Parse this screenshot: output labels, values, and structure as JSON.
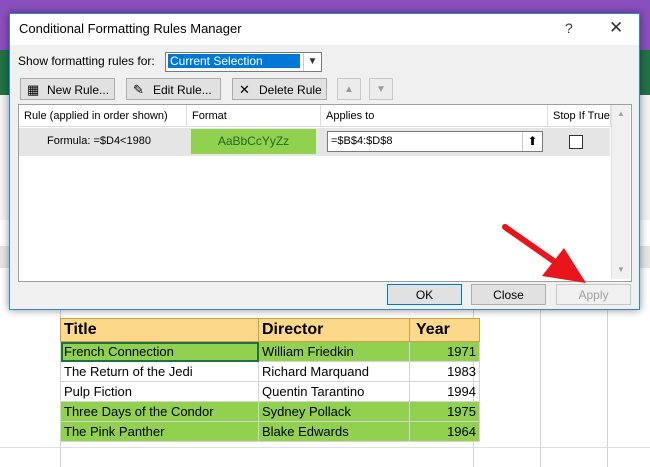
{
  "dialog": {
    "title": "Conditional Formatting Rules Manager",
    "help": "?",
    "close": "✕",
    "show_label": "Show formatting rules for:",
    "show_value": "Current Selection",
    "buttons": {
      "new_rule": "New Rule...",
      "edit_rule": "Edit Rule...",
      "delete_rule": "Delete Rule",
      "ok": "OK",
      "close": "Close",
      "apply": "Apply"
    },
    "columns": [
      "Rule (applied in order shown)",
      "Format",
      "Applies to",
      "Stop If True"
    ],
    "rule": {
      "name": "Formula: =$D4<1980",
      "format_preview": "AaBbCcYyZz",
      "applies_to": "=$B$4:$D$8"
    }
  },
  "sheet": {
    "headers": [
      "Title",
      "Director",
      "Year"
    ],
    "rows": [
      {
        "title": "French Connection",
        "director": "William Friedkin",
        "year": "1971",
        "highlight": true
      },
      {
        "title": "The Return of the Jedi",
        "director": "Richard Marquand",
        "year": "1983",
        "highlight": false
      },
      {
        "title": "Pulp Fiction",
        "director": "Quentin Tarantino",
        "year": "1994",
        "highlight": false
      },
      {
        "title": "Three Days of the Condor",
        "director": "Sydney Pollack",
        "year": "1975",
        "highlight": true
      },
      {
        "title": "The Pink Panther",
        "director": "Blake Edwards",
        "year": "1964",
        "highlight": true
      }
    ]
  },
  "colors": {
    "highlight": "#92d050",
    "header": "#fcd88a",
    "arrow": "#e8161c",
    "accent": "#0078d7"
  }
}
